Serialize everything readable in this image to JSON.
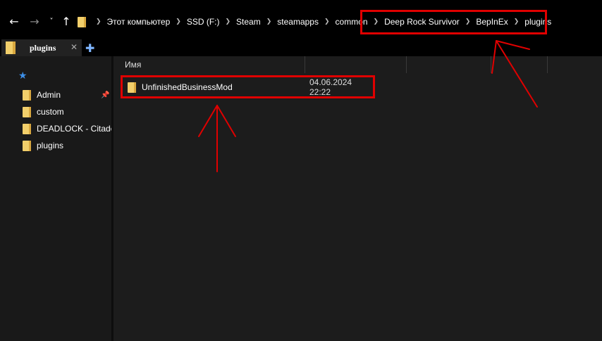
{
  "nav": {
    "back": "←",
    "forward": "→",
    "recent": "˅",
    "up": "↑"
  },
  "breadcrumbs": [
    "Этот компьютер",
    "SSD (F:)",
    "Steam",
    "steamapps",
    "common",
    "Deep Rock Survivor",
    "BepInEx",
    "plugins"
  ],
  "tab": {
    "label": "plugins",
    "close": "✕",
    "new": "✚"
  },
  "sidebar": {
    "quick_access_icon": "star-icon",
    "items": [
      {
        "label": "Admin",
        "pinned": true
      },
      {
        "label": "custom"
      },
      {
        "label": "DEADLOCK - Citadel"
      },
      {
        "label": "plugins"
      }
    ]
  },
  "columns": {
    "name": "Имя"
  },
  "files": [
    {
      "name": "UnfinishedBusinessMod",
      "date": "04.06.2024 22:22",
      "icon": "folder-icon"
    }
  ],
  "colors": {
    "highlight": "#e00000",
    "folder": "#f2cf6b",
    "accent": "#3d8fe8"
  }
}
